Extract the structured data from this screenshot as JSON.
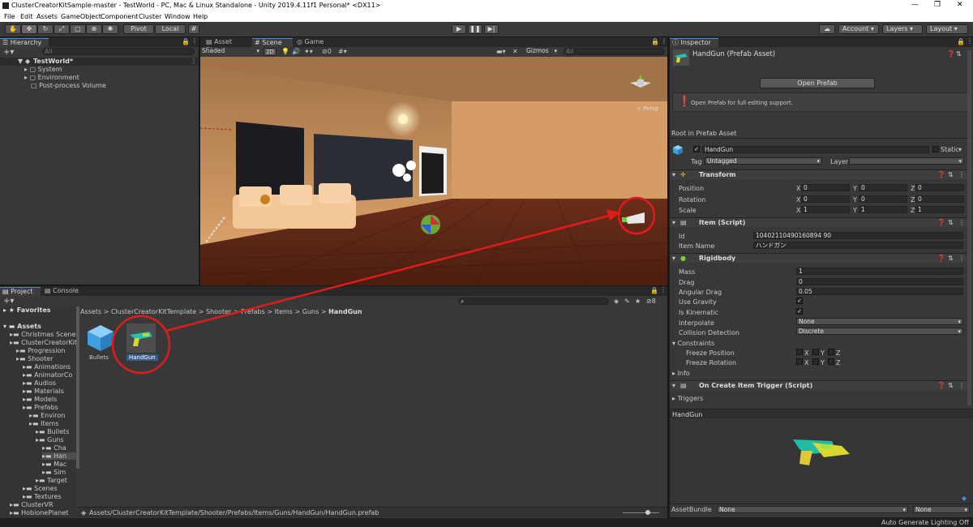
{
  "window": {
    "title": "ClusterCreatorKitSample-master - TestWorld - PC, Mac & Linux Standalone - Unity 2019.4.11f1 Personal* <DX11>"
  },
  "menu": [
    "File",
    "Edit",
    "Assets",
    "GameObject",
    "Component",
    "Cluster",
    "Window",
    "Help"
  ],
  "toolbar": {
    "pivot": "Pivot",
    "local": "Local",
    "account": "Account",
    "layers": "Layers",
    "layout": "Layout"
  },
  "hierarchy": {
    "tab": "Hierarchy",
    "search": "All",
    "scene": "TestWorld*",
    "items": [
      "System",
      "Environment",
      "Post-process Volume"
    ]
  },
  "scene_tabs": {
    "asset_store": "Asset Store",
    "scene": "Scene",
    "game": "Game",
    "shading": "Shaded",
    "mode2d": "2D",
    "gizmos": "Gizmos",
    "search": "All",
    "persp": "< Persp",
    "gizmo_count": "0"
  },
  "project": {
    "tab_project": "Project",
    "tab_console": "Console",
    "favorites": "Favorites",
    "assets": "Assets",
    "tree": [
      {
        "label": "Christmas Scene",
        "indent": 1
      },
      {
        "label": "ClusterCreatorKit",
        "indent": 1
      },
      {
        "label": "Progression",
        "indent": 2
      },
      {
        "label": "Shooter",
        "indent": 2
      },
      {
        "label": "Animations",
        "indent": 3
      },
      {
        "label": "AnimatorCo",
        "indent": 3
      },
      {
        "label": "Audios",
        "indent": 3
      },
      {
        "label": "Materials",
        "indent": 3
      },
      {
        "label": "Models",
        "indent": 3
      },
      {
        "label": "Prefabs",
        "indent": 3
      },
      {
        "label": "Environ",
        "indent": 4
      },
      {
        "label": "Items",
        "indent": 4
      },
      {
        "label": "Bullets",
        "indent": 5
      },
      {
        "label": "Guns",
        "indent": 5
      },
      {
        "label": "Cha",
        "indent": 6
      },
      {
        "label": "Han",
        "indent": 6
      },
      {
        "label": "Mac",
        "indent": 6
      },
      {
        "label": "Sim",
        "indent": 6
      },
      {
        "label": "Target",
        "indent": 5
      },
      {
        "label": "Scenes",
        "indent": 3
      },
      {
        "label": "Textures",
        "indent": 3
      },
      {
        "label": "ClusterVR",
        "indent": 1
      },
      {
        "label": "HobionePlanet",
        "indent": 1
      }
    ],
    "breadcrumb": [
      "Assets",
      "ClusterCreatorKitTemplate",
      "Shooter",
      "Prefabs",
      "Items",
      "Guns",
      "HandGun"
    ],
    "files": [
      "Bullets",
      "HandGun"
    ],
    "path": "Assets/ClusterCreatorKitTemplate/Shooter/Prefabs/Items/Guns/HandGun/HandGun.prefab",
    "count": "8"
  },
  "inspector": {
    "tab": "Inspector",
    "title": "HandGun (Prefab Asset)",
    "open_prefab": "Open Prefab",
    "info": "Open Prefab for full editing support.",
    "root": "Root in Prefab Asset",
    "name": "HandGun",
    "static": "Static",
    "tag_label": "Tag",
    "tag": "Untagged",
    "layer_label": "Layer",
    "layer": "",
    "transform": {
      "title": "Transform",
      "position": {
        "label": "Position",
        "x": "0",
        "y": "0",
        "z": "0"
      },
      "rotation": {
        "label": "Rotation",
        "x": "0",
        "y": "0",
        "z": "0"
      },
      "scale": {
        "label": "Scale",
        "x": "1",
        "y": "1",
        "z": "1"
      }
    },
    "item": {
      "title": "Item (Script)",
      "id_label": "Id",
      "id": "10402110490160894 90",
      "name_label": "Item Name",
      "name": "ハンドガン"
    },
    "rigidbody": {
      "title": "Rigidbody",
      "mass_label": "Mass",
      "mass": "1",
      "drag_label": "Drag",
      "drag": "0",
      "adrag_label": "Angular Drag",
      "adrag": "0.05",
      "gravity_label": "Use Gravity",
      "kinematic_label": "Is Kinematic",
      "interp_label": "Interpolate",
      "interp": "None",
      "coll_label": "Collision Detection",
      "coll": "Discrete",
      "constraints": "Constraints",
      "freeze_pos": "Freeze Position",
      "freeze_rot": "Freeze Rotation",
      "info": "Info"
    },
    "trigger": {
      "title": "On Create Item Trigger (Script)",
      "triggers": "Triggers"
    },
    "preview": "HandGun",
    "assetbundle_label": "AssetBundle",
    "assetbundle": "None",
    "assetbundle2": "None"
  },
  "status": {
    "lighting": "Auto Generate Lighting Off"
  },
  "colors": {
    "accent": "#4a8ad8",
    "annotation": "#e01b1b"
  }
}
